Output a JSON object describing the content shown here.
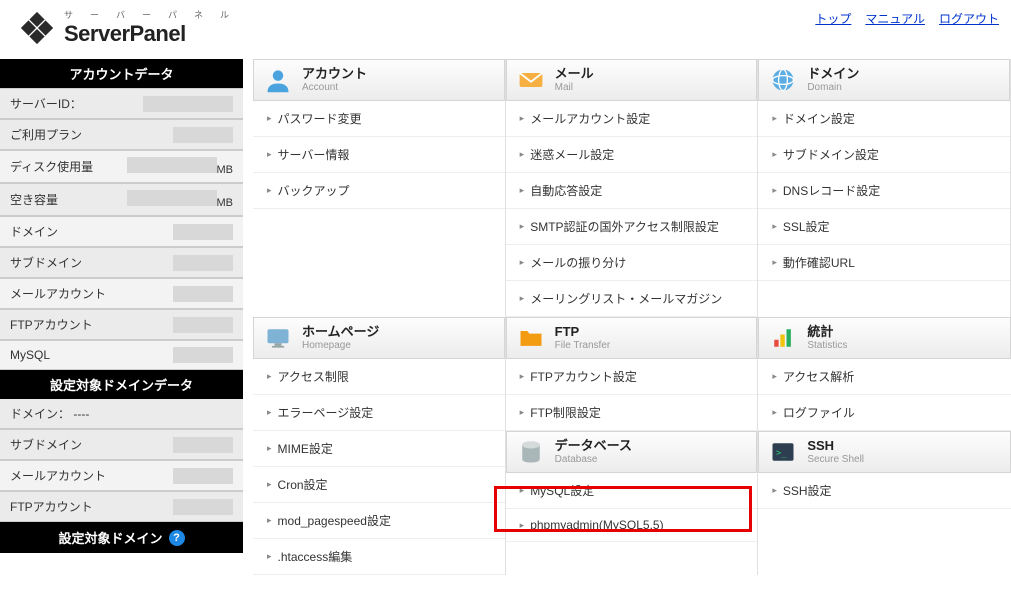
{
  "header": {
    "logo_sub": "サ　ー　バ　ー　パ　ネ　ル",
    "logo_main": "ServerPanel",
    "links": {
      "top": "トップ",
      "manual": "マニュアル",
      "logout": "ログアウト"
    }
  },
  "sidebar": {
    "account_header": "アカウントデータ",
    "rows": {
      "server_id_label": "サーバーID：",
      "plan_label": "ご利用プラン",
      "disk_label": "ディスク使用量",
      "disk_unit": "MB",
      "free_label": "空き容量",
      "free_unit": "MB",
      "domain_label": "ドメイン",
      "subdomain_label": "サブドメイン",
      "mail_label": "メールアカウント",
      "ftp_label": "FTPアカウント",
      "mysql_label": "MySQL"
    },
    "domain_header": "設定対象ドメインデータ",
    "domain_rows": {
      "domain_label": "ドメイン：",
      "domain_value": "----",
      "subdomain_label": "サブドメイン",
      "mail_label": "メールアカウント",
      "ftp_label": "FTPアカウント"
    },
    "footer": "設定対象ドメイン"
  },
  "sections": {
    "account": {
      "ja": "アカウント",
      "en": "Account",
      "items": [
        "パスワード変更",
        "サーバー情報",
        "バックアップ"
      ]
    },
    "mail": {
      "ja": "メール",
      "en": "Mail",
      "items": [
        "メールアカウント設定",
        "迷惑メール設定",
        "自動応答設定",
        "SMTP認証の国外アクセス制限設定",
        "メールの振り分け",
        "メーリングリスト・メールマガジン"
      ]
    },
    "domain": {
      "ja": "ドメイン",
      "en": "Domain",
      "items": [
        "ドメイン設定",
        "サブドメイン設定",
        "DNSレコード設定",
        "SSL設定",
        "動作確認URL"
      ]
    },
    "homepage": {
      "ja": "ホームページ",
      "en": "Homepage",
      "items": [
        "アクセス制限",
        "エラーページ設定",
        "MIME設定",
        "Cron設定",
        "mod_pagespeed設定",
        ".htaccess編集"
      ]
    },
    "ftp": {
      "ja": "FTP",
      "en": "File Transfer",
      "items": [
        "FTPアカウント設定",
        "FTP制限設定"
      ]
    },
    "stats": {
      "ja": "統計",
      "en": "Statistics",
      "items": [
        "アクセス解析",
        "ログファイル"
      ]
    },
    "db": {
      "ja": "データベース",
      "en": "Database",
      "items": [
        "MySQL設定",
        "phpmyadmin(MySQL5.5)"
      ]
    },
    "ssh": {
      "ja": "SSH",
      "en": "Secure Shell",
      "items": [
        "SSH設定"
      ]
    }
  }
}
